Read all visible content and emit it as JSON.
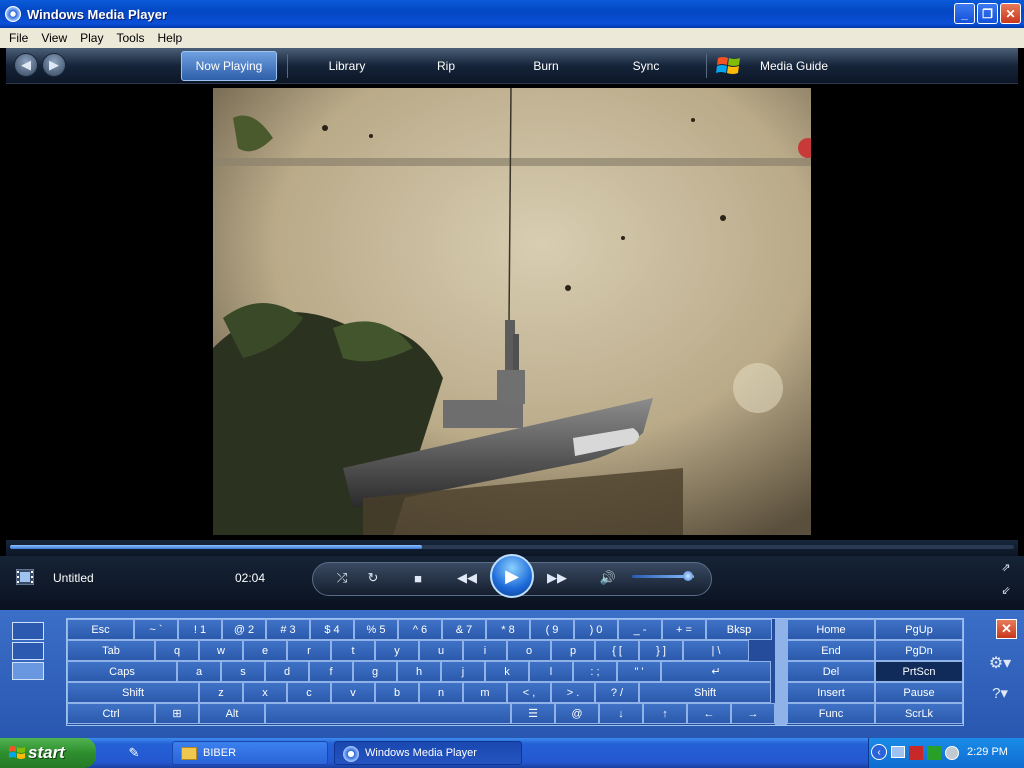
{
  "window": {
    "title": "Windows Media Player",
    "minimize_icon": "minimize-icon",
    "maximize_icon": "restore-icon",
    "close_icon": "close-icon"
  },
  "menu": [
    "File",
    "View",
    "Play",
    "Tools",
    "Help"
  ],
  "nav": {
    "tabs": [
      "Now Playing",
      "Library",
      "Rip",
      "Burn",
      "Sync",
      "Media Guide"
    ],
    "active_tab": "Now Playing"
  },
  "playback": {
    "track_title": "Untitled",
    "elapsed": "02:04",
    "progress_fraction": 0.41,
    "volume_fraction": 0.9
  },
  "osk": {
    "rows": [
      [
        "Esc",
        "~ `",
        "! 1",
        "@ 2",
        "# 3",
        "$ 4",
        "% 5",
        "^ 6",
        "& 7",
        "* 8",
        "( 9",
        ") 0",
        "_ -",
        "+ =",
        "Bksp"
      ],
      [
        "Tab",
        "q",
        "w",
        "e",
        "r",
        "t",
        "y",
        "u",
        "i",
        "o",
        "p",
        "{ [",
        "} ]",
        "| \\"
      ],
      [
        "Caps",
        "a",
        "s",
        "d",
        "f",
        "g",
        "h",
        "j",
        "k",
        "l",
        ": ;",
        "\" '",
        "↵"
      ],
      [
        "Shift",
        "z",
        "x",
        "c",
        "v",
        "b",
        "n",
        "m",
        "< ,",
        "> .",
        "? /",
        "Shift"
      ],
      [
        "Ctrl",
        "⊞",
        "Alt",
        "",
        "☰",
        "@",
        "↓",
        "↑",
        "←",
        "→"
      ]
    ],
    "nav_keys": [
      [
        "Home",
        "PgUp"
      ],
      [
        "End",
        "PgDn"
      ],
      [
        "Del",
        "PrtScn"
      ],
      [
        "Insert",
        "Pause"
      ],
      [
        "Func",
        "ScrLk"
      ]
    ]
  },
  "taskbar": {
    "start_label": "start",
    "items": [
      "BIBER",
      "Windows Media Player"
    ],
    "clock": "2:29 PM"
  }
}
